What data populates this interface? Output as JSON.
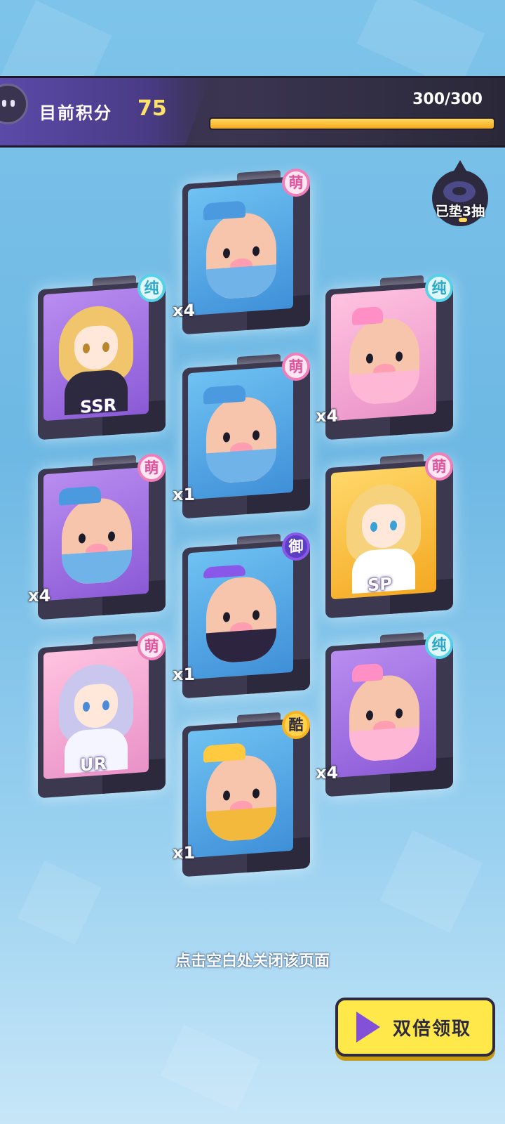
{
  "header": {
    "score_label": "目前积分",
    "score_value": "75",
    "progress_text": "300/300",
    "progress_fraction": 1.0
  },
  "pity_badge": {
    "text": "已垫3抽"
  },
  "cards": [
    {
      "trait": "萌",
      "trait_type": "meng",
      "count": "x4",
      "art": "blue",
      "kind": "pig-blue"
    },
    {
      "trait": "纯",
      "trait_type": "chun",
      "rarity": "SSR",
      "art": "purple",
      "kind": "girl-blonde"
    },
    {
      "trait": "纯",
      "trait_type": "chun",
      "count": "x4",
      "art": "pink",
      "kind": "pig-pink"
    },
    {
      "trait": "萌",
      "trait_type": "meng",
      "count": "x1",
      "art": "blue",
      "kind": "pig-blue"
    },
    {
      "trait": "萌",
      "trait_type": "meng",
      "count": "x4",
      "art": "purple",
      "kind": "pig-blue"
    },
    {
      "trait": "萌",
      "trait_type": "meng",
      "rarity": "SP",
      "art": "yellow",
      "kind": "girl-captain"
    },
    {
      "trait": "御",
      "trait_type": "yu",
      "count": "x1",
      "art": "blue",
      "kind": "pig-dark"
    },
    {
      "trait": "萌",
      "trait_type": "meng",
      "rarity": "UR",
      "art": "pink",
      "kind": "girl-silver"
    },
    {
      "trait": "纯",
      "trait_type": "chun",
      "count": "x4",
      "art": "purple",
      "kind": "pig-pink"
    },
    {
      "trait": "酷",
      "trait_type": "ku",
      "count": "x1",
      "art": "blue",
      "kind": "pig-yellow"
    }
  ],
  "hint": "点击空白处关闭该页面",
  "claim_button": {
    "label": "双倍领取"
  },
  "colors": {
    "accent": "#ffe94a",
    "dark": "#2d2a3f",
    "progress": "#f7a91b"
  }
}
